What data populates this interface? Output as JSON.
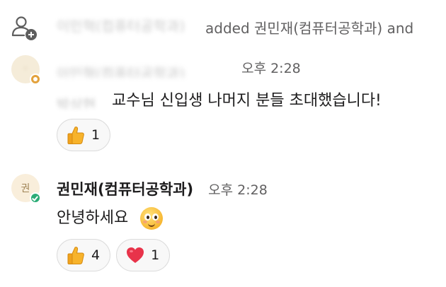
{
  "system_line": {
    "blurred_name": "이민혁(컴퓨터공학과)",
    "text": "added 권민재(컴퓨터공학과) and"
  },
  "messages": [
    {
      "sender_blurred": "이민혁(컴퓨터공학과)",
      "time": "오후 2:28",
      "mention_blurred": "박상현",
      "text": "교수님 신입생 나머지 분들 초대했습니다!",
      "reactions": [
        {
          "icon": "thumbs-up-icon",
          "count": "1"
        }
      ]
    },
    {
      "avatar_initial": "권",
      "sender": "권민재(컴퓨터공학과)",
      "time": "오후 2:28",
      "text": "안녕하세요",
      "emoji": "face-emoji-icon",
      "reactions": [
        {
          "icon": "thumbs-up-icon",
          "count": "4"
        },
        {
          "icon": "heart-icon",
          "count": "1"
        }
      ]
    }
  ],
  "colors": {
    "away_status": "#e3a23c",
    "active_status": "#2bac76",
    "heart": "#e8334a",
    "thumb": "#f7b32b"
  }
}
